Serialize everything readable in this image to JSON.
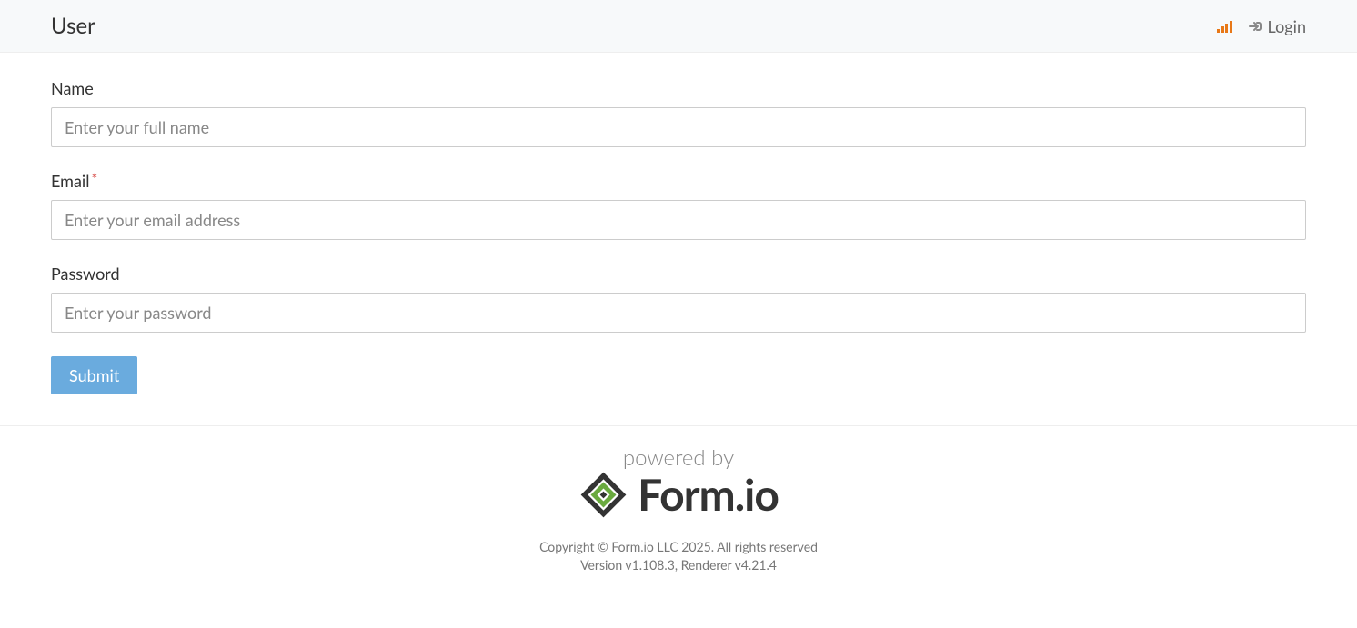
{
  "header": {
    "title": "User",
    "login_label": "Login"
  },
  "form": {
    "fields": [
      {
        "label": "Name",
        "placeholder": "Enter your full name",
        "required": false,
        "type": "text"
      },
      {
        "label": "Email",
        "placeholder": "Enter your email address",
        "required": true,
        "type": "text"
      },
      {
        "label": "Password",
        "placeholder": "Enter your password",
        "required": false,
        "type": "password"
      }
    ],
    "submit_label": "Submit"
  },
  "footer": {
    "powered_by": "powered by",
    "brand": "Form.io",
    "copyright": "Copyright © Form.io LLC 2025. All rights reserved",
    "version": "Version v1.108.3, Renderer v4.21.4"
  }
}
